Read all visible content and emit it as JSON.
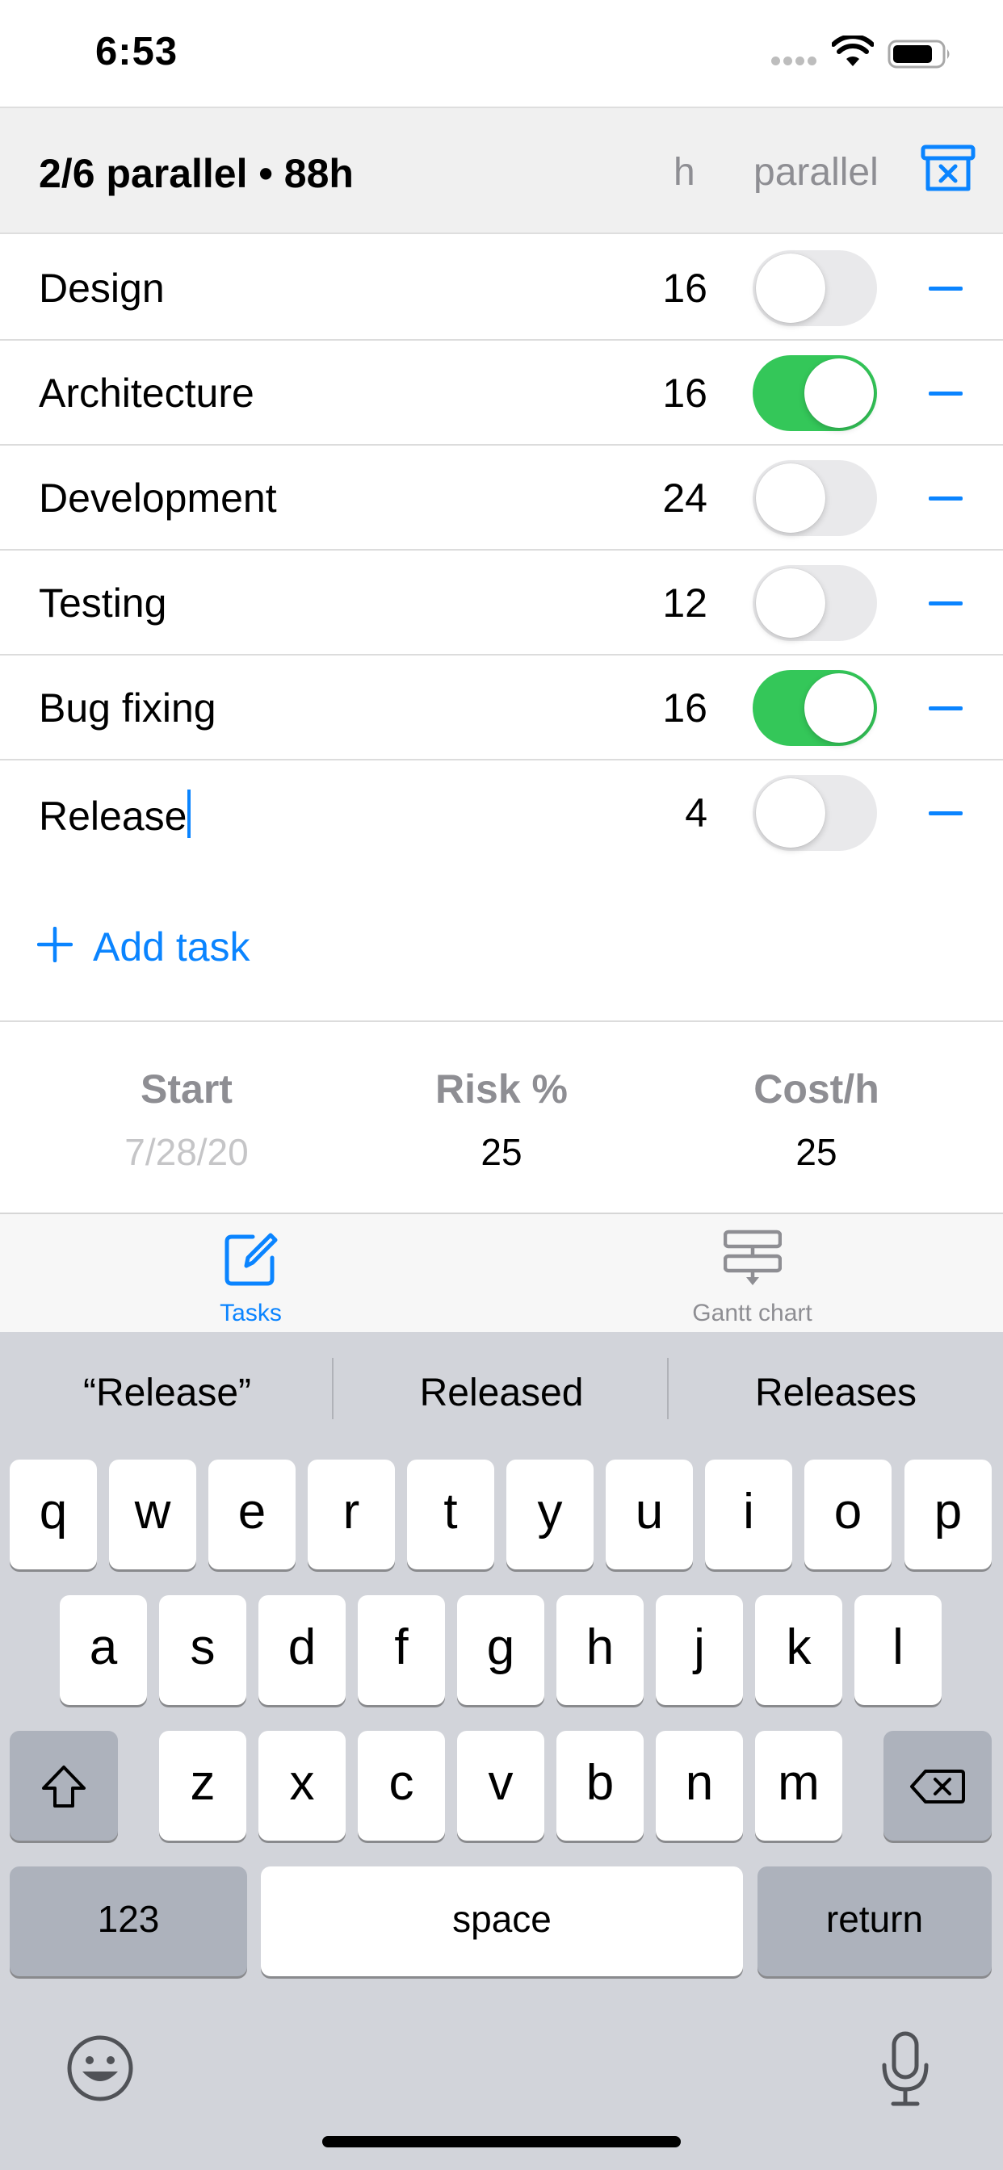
{
  "status_bar": {
    "time": "6:53"
  },
  "header": {
    "summary": "2/6 parallel • 88h",
    "col_hours": "h",
    "col_parallel": "parallel",
    "clear_icon": "archive-x-icon"
  },
  "tasks": [
    {
      "name": "Design",
      "hours": "16",
      "parallel": false
    },
    {
      "name": "Architecture",
      "hours": "16",
      "parallel": true
    },
    {
      "name": "Development",
      "hours": "24",
      "parallel": false
    },
    {
      "name": "Testing",
      "hours": "12",
      "parallel": false
    },
    {
      "name": "Bug fixing",
      "hours": "16",
      "parallel": true
    },
    {
      "name": "Release",
      "hours": "4",
      "parallel": false
    }
  ],
  "add_task": {
    "label": "Add task"
  },
  "settings": {
    "start": {
      "label": "Start",
      "value": "7/28/20"
    },
    "risk": {
      "label": "Risk %",
      "value": "25"
    },
    "cost": {
      "label": "Cost/h",
      "value": "25"
    }
  },
  "tab_bar": {
    "tabs": [
      {
        "label": "Tasks",
        "icon": "edit-square-icon",
        "active": true
      },
      {
        "label": "Gantt chart",
        "icon": "gantt-chart-icon",
        "active": false
      }
    ]
  },
  "keyboard": {
    "suggestions": [
      "“Release”",
      "Released",
      "Releases"
    ],
    "row1": [
      "q",
      "w",
      "e",
      "r",
      "t",
      "y",
      "u",
      "i",
      "o",
      "p"
    ],
    "row2": [
      "a",
      "s",
      "d",
      "f",
      "g",
      "h",
      "j",
      "k",
      "l"
    ],
    "row3": [
      "z",
      "x",
      "c",
      "v",
      "b",
      "n",
      "m"
    ],
    "numbers_key": "123",
    "space_key": "space",
    "return_key": "return"
  },
  "colors": {
    "accent": "#0a84ff",
    "toggle_on": "#34c759",
    "toggle_off": "#e9e9eb",
    "keyboard_bg": "#d2d4da"
  }
}
